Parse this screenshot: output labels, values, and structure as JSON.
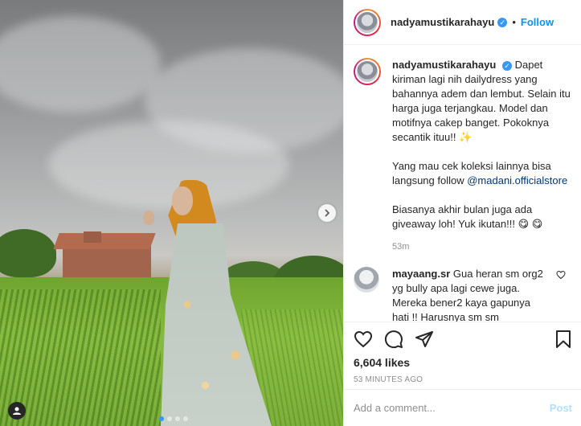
{
  "post": {
    "username": "nadyamustikarahayu",
    "verified": true,
    "follow_label": "Follow",
    "separator": "•"
  },
  "caption": {
    "username": "nadyamustikarahayu",
    "paragraph1": "Dapet kiriman lagi nih dailydress yang bahannya adem dan lembut. Selain itu harga juga terjangkau. Model dan motifnya cakep banget. Pokoknya secantik ituu!! ✨",
    "paragraph2_text": "Yang mau cek koleksi lainnya bisa langsung follow ",
    "paragraph2_mention": "@madani.officialstore",
    "paragraph3": "Biasanya akhir bulan juga ada giveaway loh! Yuk ikutan!!! 😋 😋",
    "time": "53m"
  },
  "comments": [
    {
      "username": "mayaang.sr",
      "text": "Gua heran sm org2 yg bully apa lagi cewe juga. Mereka bener2 kaya gapunya hati !! Harusnya sm sm perempuan paham. Apalagi dia lg"
    }
  ],
  "stats": {
    "likes": "6,604 likes",
    "timestamp": "53 MINUTES AGO"
  },
  "composer": {
    "placeholder": "Add a comment...",
    "post_label": "Post"
  },
  "carousel": {
    "next_icon": "chevron-right-icon",
    "slide_count": 4,
    "active_index": 0
  },
  "colors": {
    "accent": "#0095f6",
    "verified": "#3897f0",
    "mention": "#00376b",
    "muted": "#8e8e8e"
  }
}
